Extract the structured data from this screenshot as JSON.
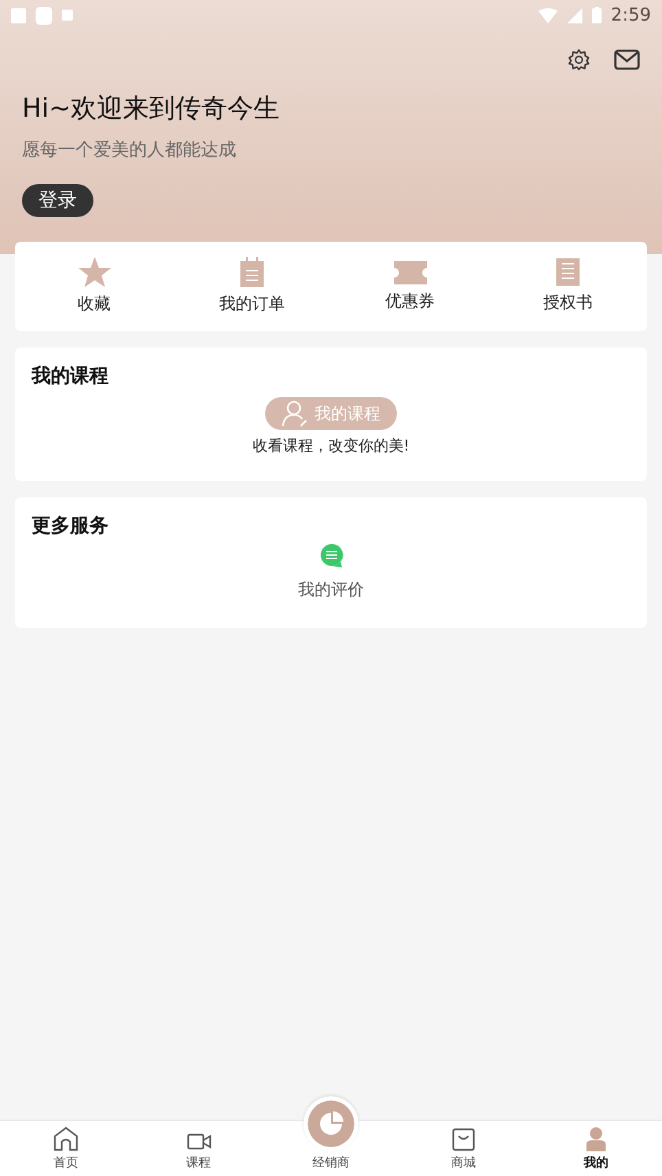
{
  "status_bar": {
    "time": "2:59"
  },
  "header": {
    "greeting": "Hi~欢迎来到传奇今生",
    "subtitle": "愿每一个爱美的人都能达成",
    "login_button": "登录"
  },
  "quick_actions": [
    {
      "label": "收藏"
    },
    {
      "label": "我的订单"
    },
    {
      "label": "优惠券"
    },
    {
      "label": "授权书"
    }
  ],
  "my_courses": {
    "title": "我的课程",
    "button": "我的课程",
    "caption": "收看课程，改变你的美!"
  },
  "more_services": {
    "title": "更多服务",
    "items": [
      {
        "label": "我的评价"
      }
    ]
  },
  "tab_bar": [
    {
      "label": "首页",
      "selected": false
    },
    {
      "label": "课程",
      "selected": false
    },
    {
      "label": "经销商",
      "selected": false
    },
    {
      "label": "商城",
      "selected": false
    },
    {
      "label": "我的",
      "selected": true
    }
  ]
}
